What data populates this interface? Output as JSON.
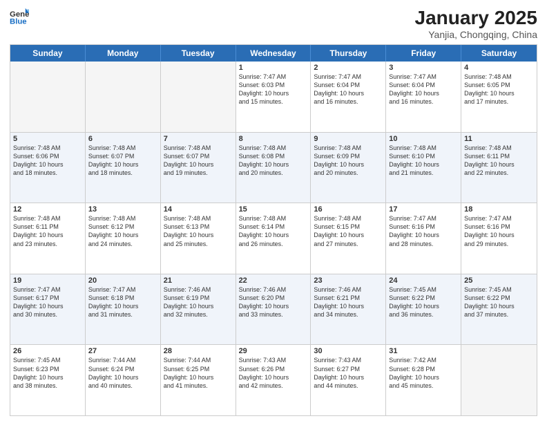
{
  "header": {
    "logo_general": "General",
    "logo_blue": "Blue",
    "title": "January 2025",
    "location": "Yanjia, Chongqing, China"
  },
  "weekdays": [
    "Sunday",
    "Monday",
    "Tuesday",
    "Wednesday",
    "Thursday",
    "Friday",
    "Saturday"
  ],
  "rows": [
    [
      {
        "day": "",
        "info": "",
        "empty": true
      },
      {
        "day": "",
        "info": "",
        "empty": true
      },
      {
        "day": "",
        "info": "",
        "empty": true
      },
      {
        "day": "1",
        "info": "Sunrise: 7:47 AM\nSunset: 6:03 PM\nDaylight: 10 hours\nand 15 minutes."
      },
      {
        "day": "2",
        "info": "Sunrise: 7:47 AM\nSunset: 6:04 PM\nDaylight: 10 hours\nand 16 minutes."
      },
      {
        "day": "3",
        "info": "Sunrise: 7:47 AM\nSunset: 6:04 PM\nDaylight: 10 hours\nand 16 minutes."
      },
      {
        "day": "4",
        "info": "Sunrise: 7:48 AM\nSunset: 6:05 PM\nDaylight: 10 hours\nand 17 minutes."
      }
    ],
    [
      {
        "day": "5",
        "info": "Sunrise: 7:48 AM\nSunset: 6:06 PM\nDaylight: 10 hours\nand 18 minutes."
      },
      {
        "day": "6",
        "info": "Sunrise: 7:48 AM\nSunset: 6:07 PM\nDaylight: 10 hours\nand 18 minutes."
      },
      {
        "day": "7",
        "info": "Sunrise: 7:48 AM\nSunset: 6:07 PM\nDaylight: 10 hours\nand 19 minutes."
      },
      {
        "day": "8",
        "info": "Sunrise: 7:48 AM\nSunset: 6:08 PM\nDaylight: 10 hours\nand 20 minutes."
      },
      {
        "day": "9",
        "info": "Sunrise: 7:48 AM\nSunset: 6:09 PM\nDaylight: 10 hours\nand 20 minutes."
      },
      {
        "day": "10",
        "info": "Sunrise: 7:48 AM\nSunset: 6:10 PM\nDaylight: 10 hours\nand 21 minutes."
      },
      {
        "day": "11",
        "info": "Sunrise: 7:48 AM\nSunset: 6:11 PM\nDaylight: 10 hours\nand 22 minutes."
      }
    ],
    [
      {
        "day": "12",
        "info": "Sunrise: 7:48 AM\nSunset: 6:11 PM\nDaylight: 10 hours\nand 23 minutes."
      },
      {
        "day": "13",
        "info": "Sunrise: 7:48 AM\nSunset: 6:12 PM\nDaylight: 10 hours\nand 24 minutes."
      },
      {
        "day": "14",
        "info": "Sunrise: 7:48 AM\nSunset: 6:13 PM\nDaylight: 10 hours\nand 25 minutes."
      },
      {
        "day": "15",
        "info": "Sunrise: 7:48 AM\nSunset: 6:14 PM\nDaylight: 10 hours\nand 26 minutes."
      },
      {
        "day": "16",
        "info": "Sunrise: 7:48 AM\nSunset: 6:15 PM\nDaylight: 10 hours\nand 27 minutes."
      },
      {
        "day": "17",
        "info": "Sunrise: 7:47 AM\nSunset: 6:16 PM\nDaylight: 10 hours\nand 28 minutes."
      },
      {
        "day": "18",
        "info": "Sunrise: 7:47 AM\nSunset: 6:16 PM\nDaylight: 10 hours\nand 29 minutes."
      }
    ],
    [
      {
        "day": "19",
        "info": "Sunrise: 7:47 AM\nSunset: 6:17 PM\nDaylight: 10 hours\nand 30 minutes."
      },
      {
        "day": "20",
        "info": "Sunrise: 7:47 AM\nSunset: 6:18 PM\nDaylight: 10 hours\nand 31 minutes."
      },
      {
        "day": "21",
        "info": "Sunrise: 7:46 AM\nSunset: 6:19 PM\nDaylight: 10 hours\nand 32 minutes."
      },
      {
        "day": "22",
        "info": "Sunrise: 7:46 AM\nSunset: 6:20 PM\nDaylight: 10 hours\nand 33 minutes."
      },
      {
        "day": "23",
        "info": "Sunrise: 7:46 AM\nSunset: 6:21 PM\nDaylight: 10 hours\nand 34 minutes."
      },
      {
        "day": "24",
        "info": "Sunrise: 7:45 AM\nSunset: 6:22 PM\nDaylight: 10 hours\nand 36 minutes."
      },
      {
        "day": "25",
        "info": "Sunrise: 7:45 AM\nSunset: 6:22 PM\nDaylight: 10 hours\nand 37 minutes."
      }
    ],
    [
      {
        "day": "26",
        "info": "Sunrise: 7:45 AM\nSunset: 6:23 PM\nDaylight: 10 hours\nand 38 minutes."
      },
      {
        "day": "27",
        "info": "Sunrise: 7:44 AM\nSunset: 6:24 PM\nDaylight: 10 hours\nand 40 minutes."
      },
      {
        "day": "28",
        "info": "Sunrise: 7:44 AM\nSunset: 6:25 PM\nDaylight: 10 hours\nand 41 minutes."
      },
      {
        "day": "29",
        "info": "Sunrise: 7:43 AM\nSunset: 6:26 PM\nDaylight: 10 hours\nand 42 minutes."
      },
      {
        "day": "30",
        "info": "Sunrise: 7:43 AM\nSunset: 6:27 PM\nDaylight: 10 hours\nand 44 minutes."
      },
      {
        "day": "31",
        "info": "Sunrise: 7:42 AM\nSunset: 6:28 PM\nDaylight: 10 hours\nand 45 minutes."
      },
      {
        "day": "",
        "info": "",
        "empty": true
      }
    ]
  ]
}
